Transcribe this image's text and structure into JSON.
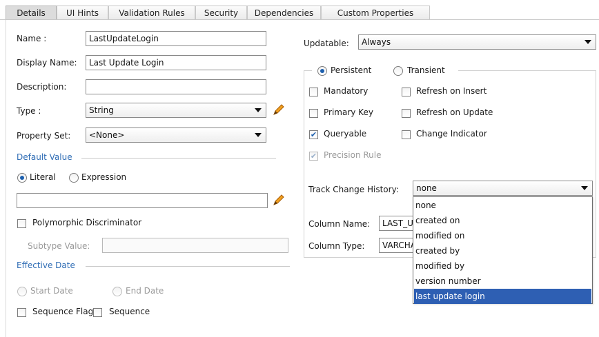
{
  "tabs": [
    {
      "label": "Details",
      "active": true
    },
    {
      "label": "UI Hints"
    },
    {
      "label": "Validation Rules"
    },
    {
      "label": "Security"
    },
    {
      "label": "Dependencies"
    },
    {
      "label": "Custom Properties"
    }
  ],
  "left": {
    "name_label": "Name :",
    "name_value": "LastUpdateLogin",
    "display_name_label": "Display Name:",
    "display_name_value": "Last Update Login",
    "description_label": "Description:",
    "description_value": "",
    "type_label": "Type :",
    "type_value": "String",
    "property_set_label": "Property Set:",
    "property_set_value": "<None>",
    "default_value_section": "Default Value",
    "literal_label": "Literal",
    "expression_label": "Expression",
    "default_value": "",
    "polymorphic_label": "Polymorphic Discriminator",
    "subtype_label": "Subtype Value:",
    "subtype_value": "",
    "effective_date_section": "Effective Date",
    "start_date_label": "Start Date",
    "end_date_label": "End Date",
    "sequence_flag_label": "Sequence Flag",
    "sequence_label": "Sequence"
  },
  "right": {
    "updatable_label": "Updatable:",
    "updatable_value": "Always",
    "persistent_label": "Persistent",
    "transient_label": "Transient",
    "mandatory_label": "Mandatory",
    "refresh_insert_label": "Refresh on Insert",
    "primary_key_label": "Primary Key",
    "refresh_update_label": "Refresh on Update",
    "queryable_label": "Queryable",
    "change_indicator_label": "Change Indicator",
    "precision_rule_label": "Precision Rule",
    "track_change_label": "Track Change History:",
    "track_change_value": "none",
    "column_name_label": "Column Name:",
    "column_name_value": "LAST_U",
    "column_type_label": "Column Type:",
    "column_type_value": "VARCHA"
  },
  "dropdown": {
    "options": [
      "none",
      "created on",
      "modified on",
      "created by",
      "modified by",
      "version number",
      "last update login"
    ],
    "selected_index": 6
  },
  "colors": {
    "accent": "#2f6db5",
    "selection": "#2e5fb3",
    "pencil": "#e07b00"
  }
}
